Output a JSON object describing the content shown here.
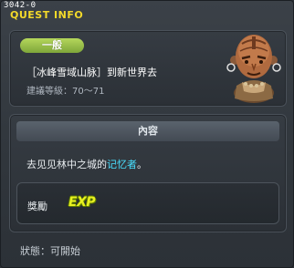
{
  "window": {
    "id_text": "3042-0",
    "title": "QUEST INFO"
  },
  "quest": {
    "category": "一般",
    "name": "［冰峰雪域山脉］到新世界去",
    "level_label": "建議等級：70～71"
  },
  "content": {
    "header": "內容",
    "text_before": "去见见林中之城的",
    "text_highlight": "记忆者",
    "text_after": "。"
  },
  "reward": {
    "label": "獎勵",
    "item": "EXP"
  },
  "status": {
    "text": "狀態：可開始"
  },
  "colors": {
    "title": "#f3d92a",
    "badge": "#9cc24a",
    "highlight": "#49e0ff",
    "exp": "#e8f021"
  }
}
